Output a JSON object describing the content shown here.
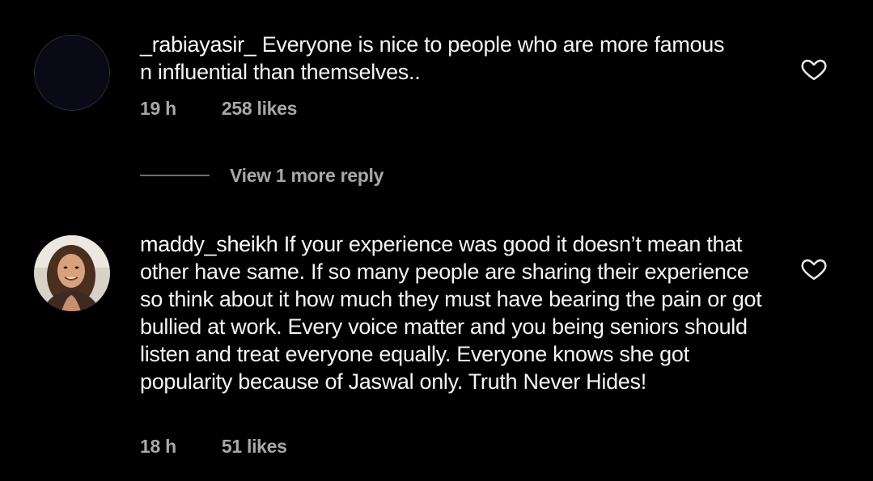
{
  "comments": [
    {
      "username": "_rabiayasir_",
      "text": "Everyone is nice to people who are more famous n influential than themselves..",
      "line1": "Everyone is nice to people who are more famous",
      "line2": "n influential than themselves..",
      "time": "19 h",
      "likes": "258 likes",
      "avatar_icon": "empty-avatar"
    },
    {
      "username": "maddy_sheikh",
      "text": "If your experience was good it doesn’t mean that other have same. If so many people are sharing their experience so think about it how much they must have bearing the pain or got bullied at work. Every voice matter and you being seniors should listen and treat everyone equally. Everyone knows she got popularity because of Jaswal only. Truth Never Hides!",
      "time": "18 h",
      "likes": "51 likes",
      "avatar_icon": "profile-photo"
    }
  ],
  "view_replies": {
    "label": "View 1 more reply"
  },
  "icons": {
    "like": "heart-outline-icon"
  },
  "colors": {
    "background": "#000000",
    "text": "#f5f5f5",
    "secondary": "#a8a8a8"
  }
}
